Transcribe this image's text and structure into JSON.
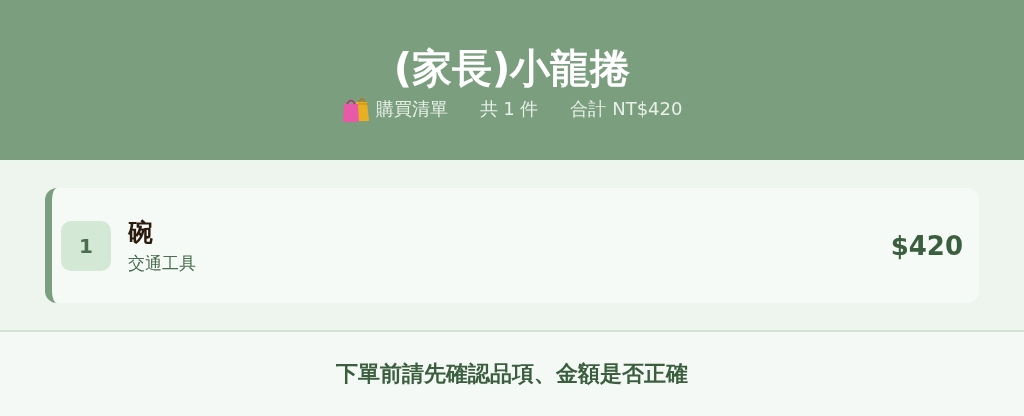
{
  "header": {
    "title": "(家長)小龍捲",
    "subtitle": {
      "list_label": "購買清單",
      "count": "共 1 件",
      "total": "合計 NT$420"
    }
  },
  "items": [
    {
      "number": "1",
      "name": "碗",
      "category": "交通工具",
      "price": "$420"
    }
  ],
  "footer": {
    "notice": "下單前請先確認品項、金額是否正確"
  }
}
